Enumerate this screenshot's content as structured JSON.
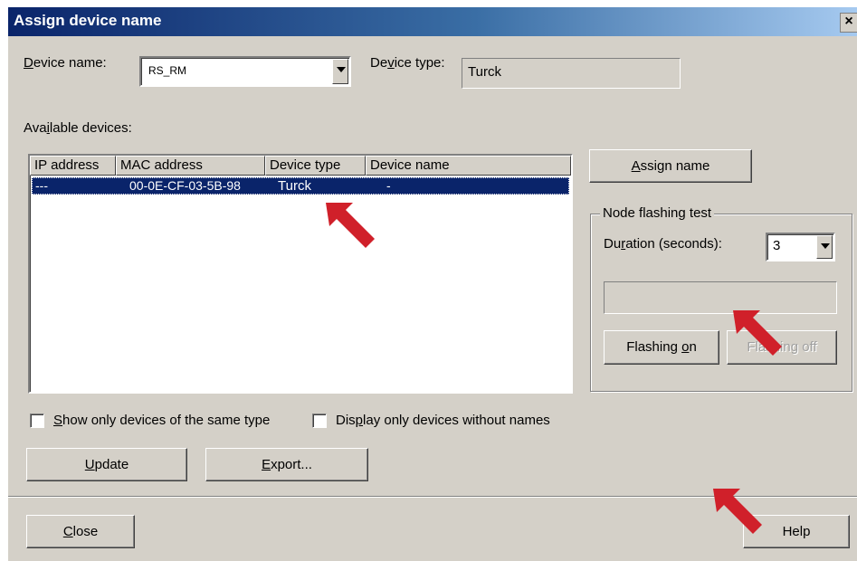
{
  "window": {
    "title": "Assign device name",
    "close_glyph": "×"
  },
  "device_name": {
    "label_pre": "D",
    "label_rest": "evice name:",
    "value": "RS_RM"
  },
  "device_type": {
    "label_pre": "De",
    "label_u": "v",
    "label_rest": "ice type:",
    "value": "Turck"
  },
  "available_devices": {
    "label_pre": "Ava",
    "label_u": "i",
    "label_rest": "lable devices:"
  },
  "table": {
    "columns": [
      "IP address",
      "MAC address",
      "Device type",
      "Device name"
    ],
    "rows": [
      {
        "ip": "---",
        "mac": "00-0E-CF-03-5B-98",
        "type": "Turck",
        "name": "-"
      }
    ]
  },
  "assign_button": {
    "u": "A",
    "rest": "ssign name"
  },
  "node_flashing": {
    "title": "Node flashing test",
    "duration_label_pre": "Du",
    "duration_label_u": "r",
    "duration_label_rest": "ation (seconds):",
    "duration_value": "3",
    "flashing_on_pre": "Flashing ",
    "flashing_on_u": "o",
    "flashing_on_rest": "n",
    "flashing_off": "Flashing off"
  },
  "checkboxes": {
    "same_type_u": "S",
    "same_type_rest": "how only devices of the same type",
    "without_names_pre": "Dis",
    "without_names_u": "p",
    "without_names_rest": "lay only devices without names"
  },
  "buttons": {
    "update_u": "U",
    "update_rest": "pdate",
    "export_u": "E",
    "export_rest": "xport...",
    "close_u": "C",
    "close_rest": "lose",
    "help": "Help"
  },
  "colors": {
    "annotation_arrow": "#d0202a",
    "selection": "#0a246a"
  },
  "icons": [
    "close-icon",
    "dropdown-arrow-icon",
    "annotation-arrow-icon"
  ]
}
